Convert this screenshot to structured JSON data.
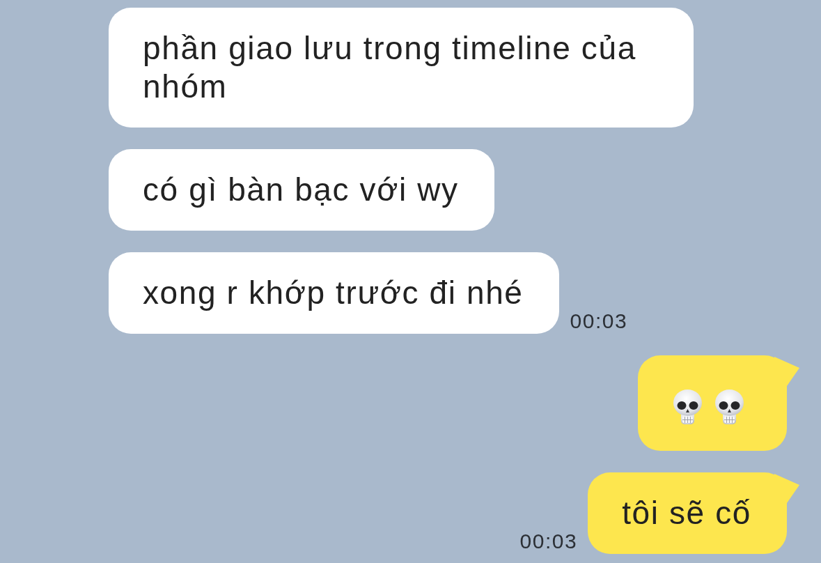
{
  "messages": [
    {
      "outgoing": false,
      "kind": "text",
      "text": "phần giao lưu trong timeline của nhóm"
    },
    {
      "outgoing": false,
      "kind": "text",
      "text": "có gì bàn bạc với wy"
    },
    {
      "outgoing": false,
      "kind": "text",
      "text": "xong r khớp trước đi nhé",
      "time": "00:03"
    },
    {
      "outgoing": true,
      "kind": "emoji",
      "emojis": [
        {
          "kind": "skull"
        },
        {
          "kind": "skull"
        }
      ]
    },
    {
      "outgoing": true,
      "kind": "text",
      "text": "tôi sẽ cố",
      "time": "00:03"
    }
  ]
}
